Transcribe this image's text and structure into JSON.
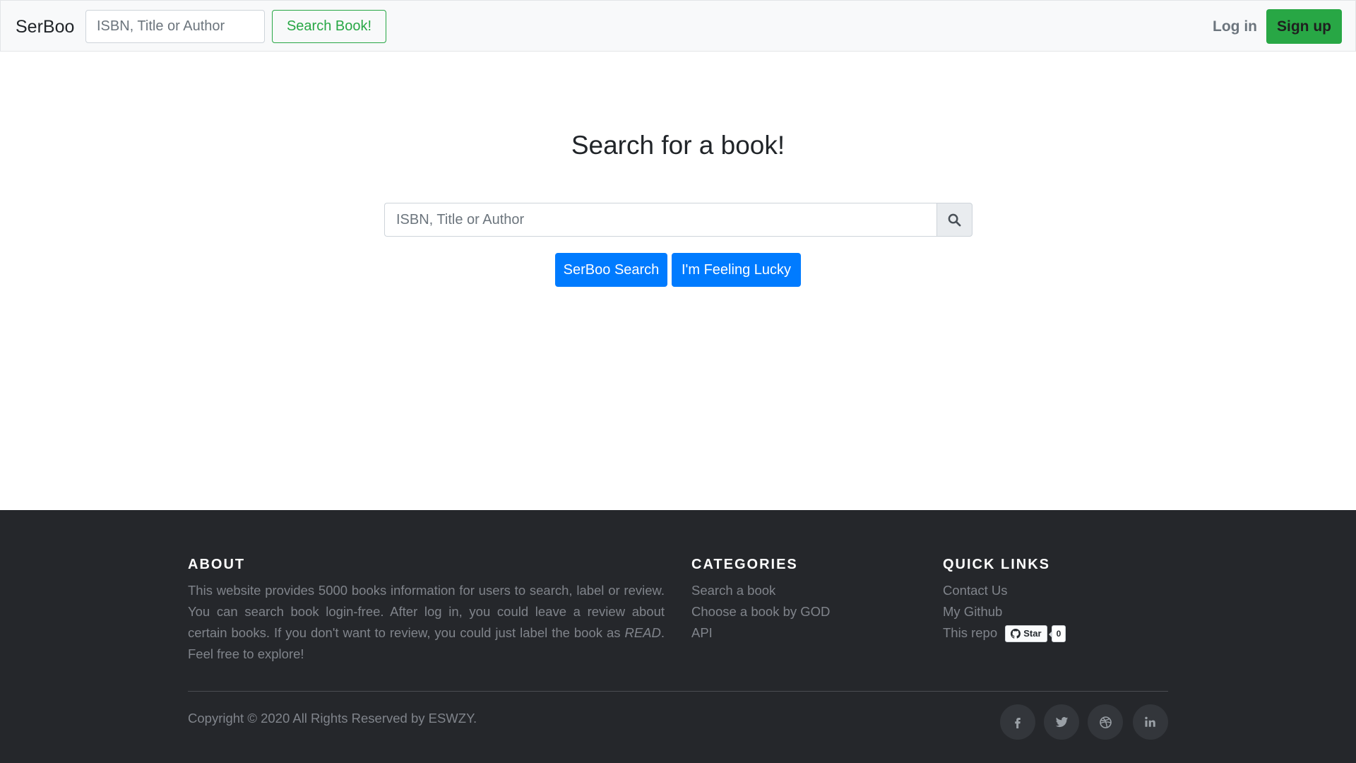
{
  "navbar": {
    "brand": "SerBoo",
    "search_placeholder": "ISBN, Title or Author",
    "search_button": "Search Book!",
    "login": "Log in",
    "signup": "Sign up"
  },
  "main": {
    "title": "Search for a book!",
    "search_placeholder": "ISBN, Title or Author",
    "search_icon": "search-icon",
    "primary_button": "SerBoo Search",
    "lucky_button": "I'm Feeling Lucky"
  },
  "footer": {
    "about": {
      "heading": "ABOUT",
      "text_before": "This website provides 5000 books information for users to search, label or review. You can search book login-free. After log in, you could leave a review about certain books. If you don't want to review, you could just label the book as ",
      "text_emphasis": "READ",
      "text_after": ". Feel free to explore!"
    },
    "categories": {
      "heading": "CATEGORIES",
      "items": [
        "Search a book",
        "Choose a book by GOD",
        "API"
      ]
    },
    "quick_links": {
      "heading": "QUICK LINKS",
      "items": [
        "Contact Us",
        "My Github"
      ],
      "repo_label": "This repo",
      "star_label": "Star",
      "star_count": "0"
    },
    "copyright": "Copyright © 2020 All Rights Reserved by ESWZY.",
    "social_icons": [
      "facebook-icon",
      "twitter-icon",
      "dribbble-icon",
      "linkedin-icon"
    ]
  },
  "colors": {
    "primary": "#007bff",
    "success": "#28a745",
    "footer_bg": "#25272b",
    "navbar_bg": "#f8f9fa"
  }
}
